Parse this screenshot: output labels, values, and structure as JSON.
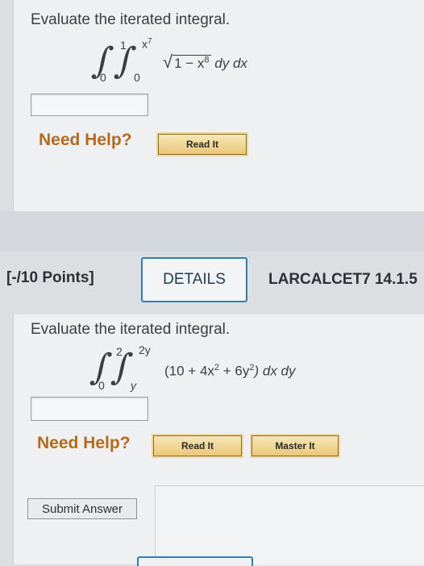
{
  "problem1": {
    "prompt": "Evaluate the iterated integral.",
    "outer_lower": "0",
    "outer_upper": "1",
    "inner_lower": "0",
    "inner_upper_base": "x",
    "inner_upper_exp": "7",
    "integrand_radicand": "1 − x",
    "integrand_exp": "8",
    "differentials": "dy dx",
    "answer_value": "",
    "need_help": "Need Help?",
    "read_it": "Read It"
  },
  "problem2_header": {
    "points": "[-/10 Points]",
    "details": "DETAILS",
    "course_code": "LARCALCET7 14.1.5"
  },
  "problem2": {
    "prompt": "Evaluate the iterated integral.",
    "outer_lower": "0",
    "outer_upper": "2",
    "inner_lower": "y",
    "inner_upper": "2y",
    "integrand_part1": "(10 + 4x",
    "exp1": "2",
    "integrand_part2": " + 6y",
    "exp2": "2",
    "integrand_part3": ") dx dy",
    "answer_value": "",
    "need_help": "Need Help?",
    "read_it": "Read It",
    "master_it": "Master It"
  },
  "submit": {
    "label": "Submit Answer"
  }
}
